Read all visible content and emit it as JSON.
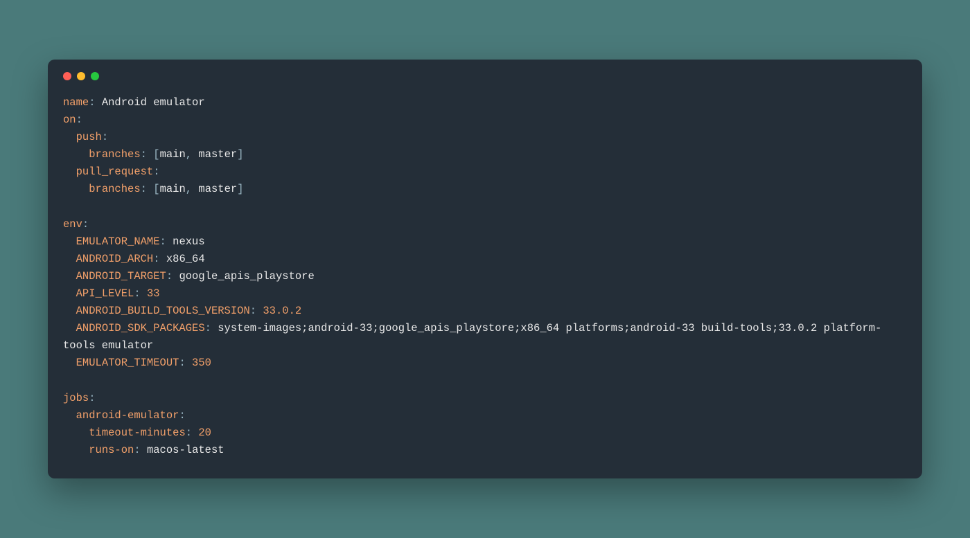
{
  "colors": {
    "background": "#4a7a7a",
    "window_bg": "#242e38",
    "key": "#f2a06a",
    "punct": "#9bb7c4",
    "value": "#e8e8e8",
    "traffic_red": "#ff5f56",
    "traffic_yellow": "#ffbd2e",
    "traffic_green": "#27c93f"
  },
  "yaml": {
    "name": "Android emulator",
    "on": {
      "push": {
        "branches": [
          "main",
          "master"
        ]
      },
      "pull_request": {
        "branches": [
          "main",
          "master"
        ]
      }
    },
    "env": {
      "EMULATOR_NAME": "nexus",
      "ANDROID_ARCH": "x86_64",
      "ANDROID_TARGET": "google_apis_playstore",
      "API_LEVEL": "33",
      "ANDROID_BUILD_TOOLS_VERSION": "33.0.2",
      "ANDROID_SDK_PACKAGES": "system-images;android-33;google_apis_playstore;x86_64 platforms;android-33 build-tools;33.0.2 platform-tools emulator",
      "EMULATOR_TIMEOUT": "350"
    },
    "jobs": {
      "android-emulator": {
        "timeout-minutes": "20",
        "runs-on": "macos-latest"
      }
    }
  },
  "labels": {
    "name": "name",
    "on": "on",
    "push": "push",
    "branches": "branches",
    "pull_request": "pull_request",
    "env": "env",
    "EMULATOR_NAME": "EMULATOR_NAME",
    "ANDROID_ARCH": "ANDROID_ARCH",
    "ANDROID_TARGET": "ANDROID_TARGET",
    "API_LEVEL": "API_LEVEL",
    "ANDROID_BUILD_TOOLS_VERSION": "ANDROID_BUILD_TOOLS_VERSION",
    "ANDROID_SDK_PACKAGES": "ANDROID_SDK_PACKAGES",
    "EMULATOR_TIMEOUT": "EMULATOR_TIMEOUT",
    "jobs": "jobs",
    "android_emulator": "android-emulator",
    "timeout_minutes": "timeout-minutes",
    "runs_on": "runs-on"
  },
  "punct": {
    "colon": ":",
    "colon_sp": ": ",
    "lbr": "[",
    "rbr": "]",
    "comma_sp": ", "
  }
}
